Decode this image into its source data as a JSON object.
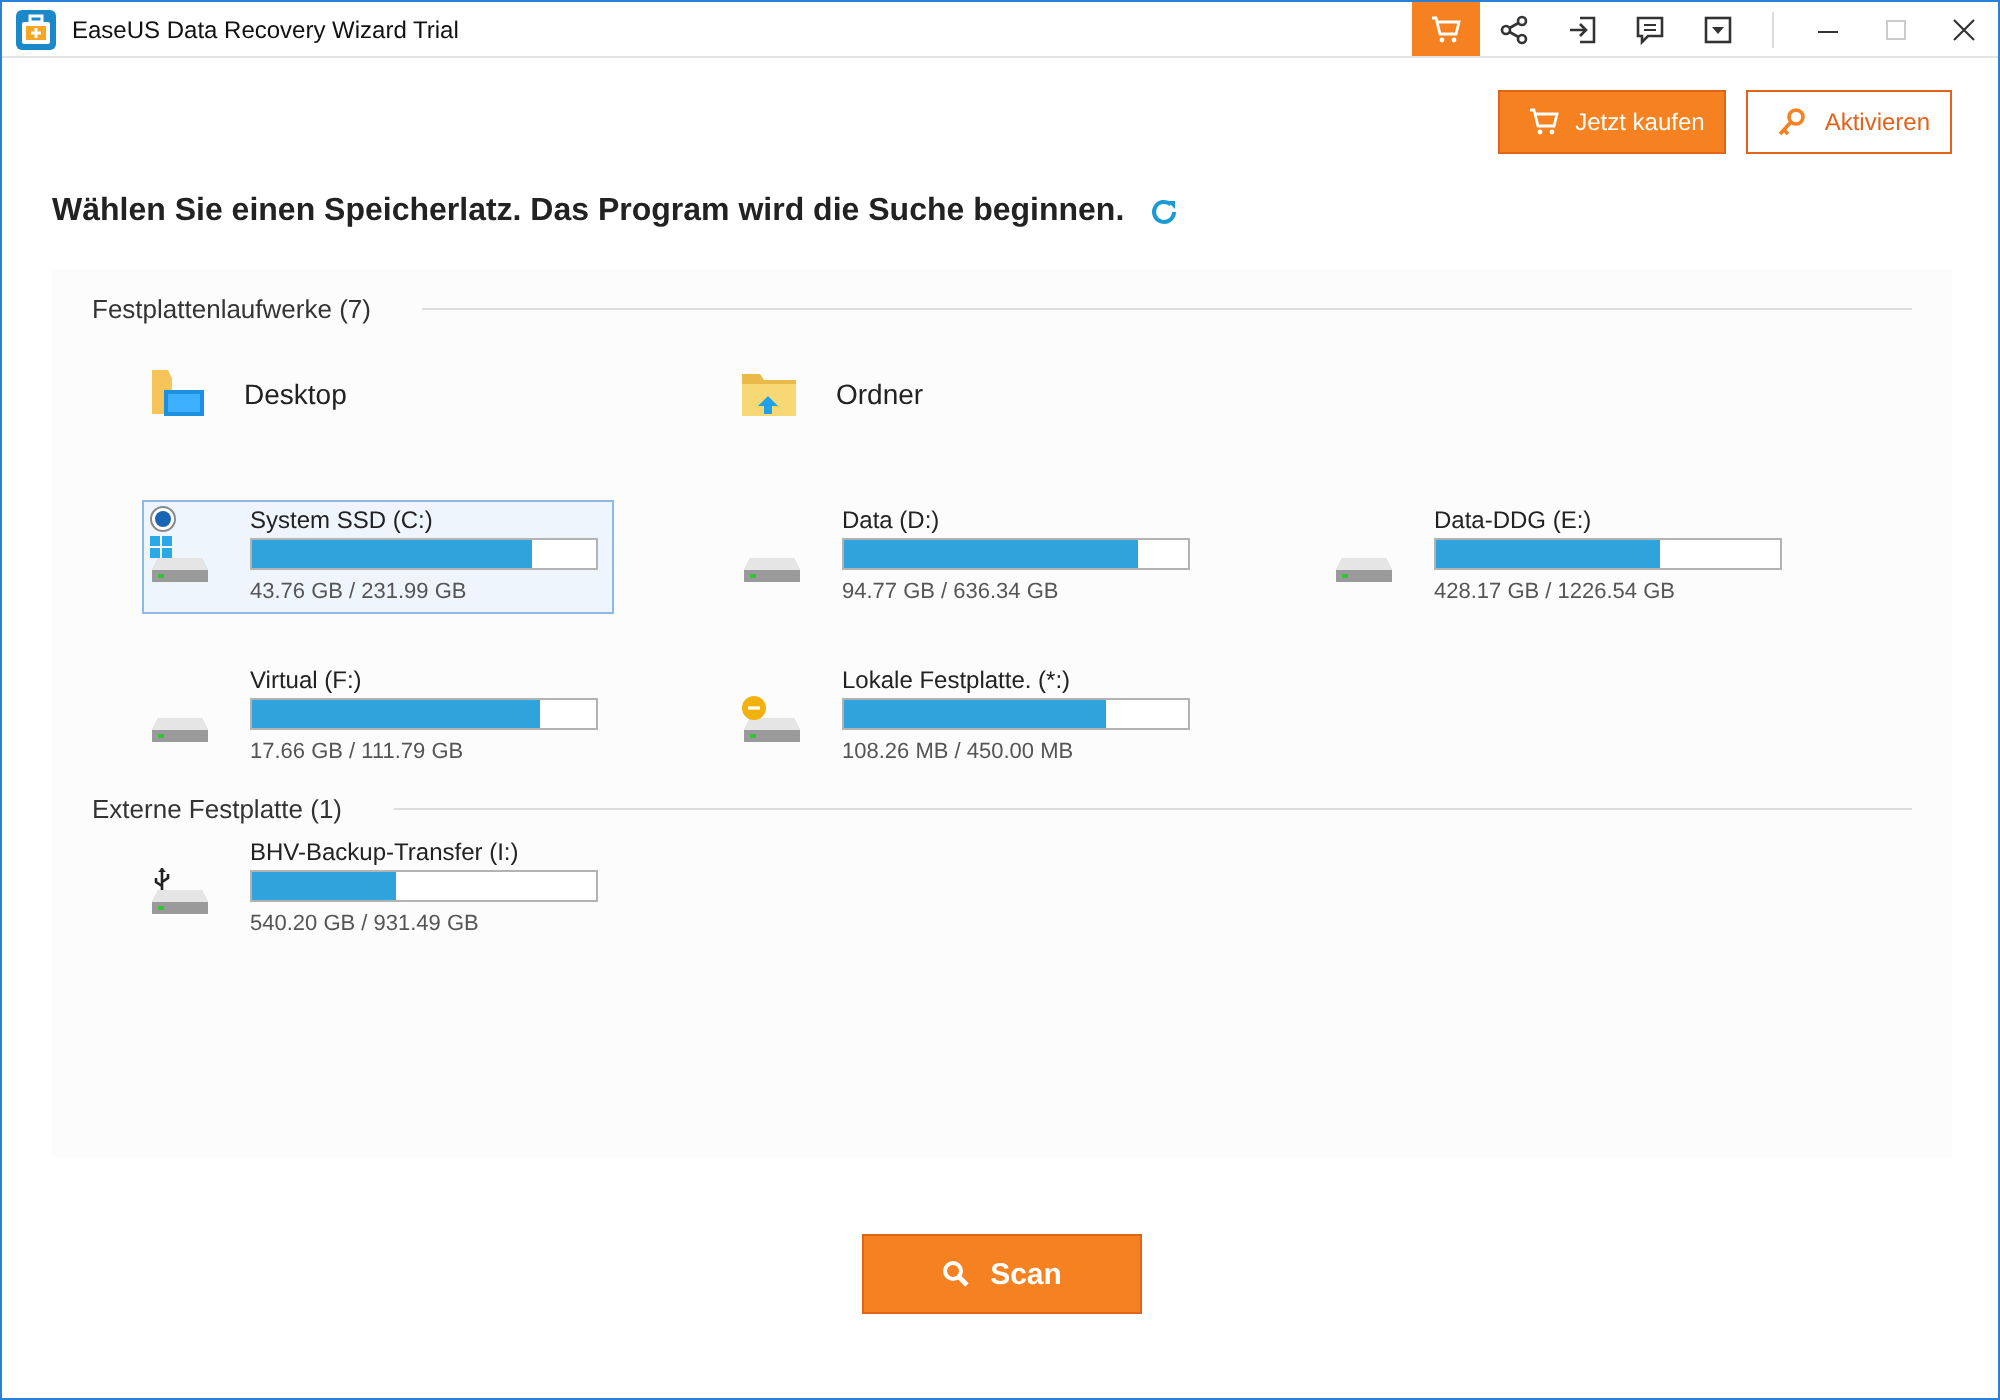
{
  "window": {
    "title": "EaseUS Data Recovery Wizard Trial"
  },
  "toolbar_icons": [
    {
      "kind": "cart",
      "selected": true
    },
    {
      "kind": "share",
      "selected": false
    },
    {
      "kind": "login",
      "selected": false
    },
    {
      "kind": "feedback",
      "selected": false
    },
    {
      "kind": "dropdown",
      "selected": false
    }
  ],
  "window_controls": [
    {
      "kind": "minimize",
      "disabled": false
    },
    {
      "kind": "maximize",
      "disabled": true
    },
    {
      "kind": "close",
      "disabled": false
    }
  ],
  "action_buttons": [
    {
      "kind": "buy",
      "label": "Jetzt kaufen"
    },
    {
      "kind": "activate",
      "label": "Aktivieren"
    }
  ],
  "heading": "Wählen Sie einen Speicherlatz. Das Program wird die Suche beginnen.",
  "sections": [
    {
      "title": "Festplattenlaufwerke (7)",
      "locations": [
        {
          "kind": "desktop",
          "label": "Desktop"
        },
        {
          "kind": "folder",
          "label": "Ordner"
        }
      ],
      "drives": [
        {
          "name": "System SSD (C:)",
          "usage": "43.76 GB / 231.99 GB",
          "level": 0.815,
          "selected": true,
          "kind": "system"
        },
        {
          "name": "Data (D:)",
          "usage": "94.77 GB / 636.34 GB",
          "level": 0.855,
          "selected": false,
          "kind": "disk"
        },
        {
          "name": "Data-DDG (E:)",
          "usage": "428.17 GB / 1226.54 GB",
          "level": 0.65,
          "selected": false,
          "kind": "disk"
        },
        {
          "name": "Virtual (F:)",
          "usage": "17.66 GB / 111.79 GB",
          "level": 0.84,
          "selected": false,
          "kind": "disk"
        },
        {
          "name": "Lokale Festplatte. (*:)",
          "usage": "108.26 MB / 450.00 MB",
          "level": 0.76,
          "selected": false,
          "kind": "unmounted"
        }
      ]
    },
    {
      "title": "Externe Festplatte (1)",
      "drives": [
        {
          "name": "BHV-Backup-Transfer (I:)",
          "usage": "540.20 GB / 931.49 GB",
          "level": 0.42,
          "selected": false,
          "kind": "usb"
        }
      ]
    }
  ],
  "scan_button": {
    "label": "Scan"
  }
}
